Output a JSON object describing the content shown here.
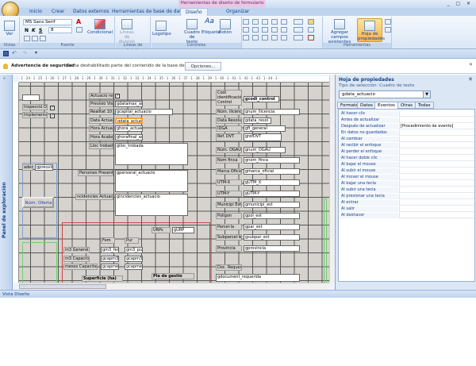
{
  "window": {
    "title": "General total : INICI",
    "context_title": "Herramientas de diseño de formulario",
    "controls": "_ ▢ ✕"
  },
  "tabs": [
    {
      "label": "Inicio"
    },
    {
      "label": "Crear"
    },
    {
      "label": "Datos externos"
    },
    {
      "label": "Herramientas de base de datos"
    },
    {
      "label": "Diseño",
      "active": true
    },
    {
      "label": "Organizar"
    }
  ],
  "ribbon": {
    "groups": [
      {
        "label": "Vistas"
      },
      {
        "label": "Fuente"
      },
      {
        "label": "Líneas de división"
      },
      {
        "label": "Controles"
      },
      {
        "label": "Herramientas"
      }
    ],
    "view_button": "Ver",
    "font_name": "MS Sans Serif",
    "font_size": "8",
    "bold": "N",
    "italic": "K",
    "underline": "S",
    "conditional": "Condicional",
    "gridlines": "Líneas de división",
    "logo": "Logotipo",
    "textbox": "Cuadro de texto",
    "label": "Etiqueta",
    "button": "Botón",
    "add_fields": "Agregar campos existentes",
    "property_sheet": "Hoja de propiedades"
  },
  "security": {
    "title": "Advertencia de seguridad",
    "message": "Se ha deshabilitado parte del contenido de la base de datos",
    "options_button": "Opciones..."
  },
  "nav_pane": {
    "label": "Panel de exploración"
  },
  "ruler": {
    "marks": "· 1 · 24 · 1 · 25 · 1 · 26 · 1 · 27 · 1 · 28 · 1 · 29 · 1 · 30 · 1 · 31 · 1 · 32 · 1 · 33 · 1 · 34 · 1 · 35 · 1 · 36 · 1 · 37 · 1 · 38 · 1 · 39 · 1 · 40 · 1 · 41 · 1 · 42 · 1 · 43 · 1 · 44 · 1 ·"
  },
  "form": {
    "labels": [
      "Inspecció DET?",
      "Implementat ?",
      "Actuació real",
      "Previsió Visita",
      "Realitat 10 m",
      "Data Actuació",
      "Hora Actuació",
      "Hora Acaba",
      "Lloc trobada",
      "ades",
      "Persones Presents",
      "ncidencies Actuació",
      "Codi identificació Control",
      "Núm. llicència",
      "Data Resolució",
      "IDGA",
      "Ref. DVT",
      "Núm. OGAU",
      "Nom finca",
      "Marca Oficial",
      "UTM-X",
      "UTM-Y",
      "Municipi Est",
      "Polígon",
      "Parcel·la",
      "Subparcel·les",
      "Província",
      "Doc. Requerida",
      "URPs",
      "Pla de gestió",
      "Fem",
      "Pur",
      "m3 General",
      "m3 Capacitat",
      "mesos Capacitat",
      "Superfície (ha)"
    ],
    "textboxes": [
      "",
      "gdatamax_act",
      "gcapital_actuacio",
      "gdata_actuacio",
      "ghora_actuacio",
      "ghorafinal_actu",
      "glloc_trobada",
      "gpreuvisi",
      "gpersonal_actuacio",
      "gincidencies_actuacio",
      "gcodi_control",
      "gnum_llicencia",
      "gdata_resol",
      "gfi_general",
      "grefDVT",
      "gnum_OGAU",
      "gnom_finca",
      "gmarca_oficial",
      "gUTM_X",
      "gUTM-Y",
      "gmunicipi_est",
      "gpol_est",
      "gpar_est",
      "gsubpar_est",
      "gprovincia",
      "gdocument_requerida",
      "gURP",
      "gm3_fem",
      "gm3_pur",
      "gcapm3_",
      "gcapm3_j",
      "gcapmes",
      "gcapmes"
    ],
    "checkboxes": [
      {
        "checked": true
      },
      {
        "checked": true
      },
      {
        "checked": true
      }
    ],
    "offer_button": "Núm. Oferta",
    "selected_control": "gdata_actuacio"
  },
  "property_sheet": {
    "title": "Hoja de propiedades",
    "selection_type": "Tipo de selección: Cuadro de texto",
    "selected": "gdata_actuacio",
    "tabs": [
      {
        "label": "Formato"
      },
      {
        "label": "Datos"
      },
      {
        "label": "Eventos",
        "active": true
      },
      {
        "label": "Otras"
      },
      {
        "label": "Todas"
      }
    ],
    "rows": [
      {
        "name": "Al hacer clic",
        "value": ""
      },
      {
        "name": "Antes de actualizar",
        "value": ""
      },
      {
        "name": "Después de actualizar",
        "value": "[Procedimiento de evento]"
      },
      {
        "name": "En datos no guardados",
        "value": ""
      },
      {
        "name": "Al cambiar",
        "value": ""
      },
      {
        "name": "Al recibir el enfoque",
        "value": ""
      },
      {
        "name": "Al perder el enfoque",
        "value": ""
      },
      {
        "name": "Al hacer doble clic",
        "value": ""
      },
      {
        "name": "Al bajar el mouse",
        "value": ""
      },
      {
        "name": "Al subir el mouse",
        "value": ""
      },
      {
        "name": "Al mover el mouse",
        "value": ""
      },
      {
        "name": "Al bajar una tecla",
        "value": ""
      },
      {
        "name": "Al subir una tecla",
        "value": ""
      },
      {
        "name": "Al presionar una tecla",
        "value": ""
      },
      {
        "name": "Al entrar",
        "value": ""
      },
      {
        "name": "Al salir",
        "value": ""
      },
      {
        "name": "Al deshacer",
        "value": ""
      }
    ]
  },
  "status": {
    "text": "Vista Diseño"
  },
  "colors": {
    "accent": "#15428b",
    "selection": "#f3a23a",
    "ribbon_bg": "#dbe7f6",
    "surface": "#d6d3ce"
  }
}
